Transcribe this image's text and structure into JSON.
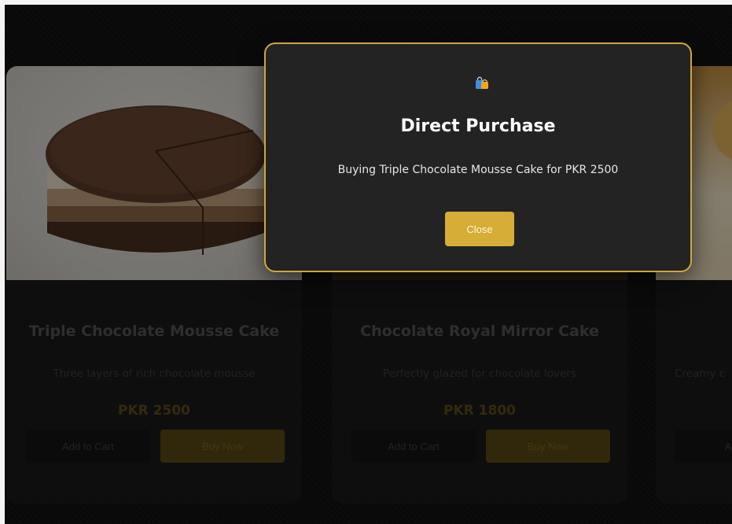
{
  "products": [
    {
      "title": "Triple Chocolate Mousse Cake",
      "description": "Three layers of rich chocolate mousse",
      "price": "PKR 2500",
      "add_to_cart_label": "Add to Cart",
      "buy_now_label": "Buy Now"
    },
    {
      "title": "Chocolate Royal Mirror Cake",
      "description": "Perfectly glazed for chocolate lovers",
      "price": "PKR 1800",
      "add_to_cart_label": "Add to Cart",
      "buy_now_label": "Buy Now"
    },
    {
      "title": "",
      "description": "Creamy c",
      "price": "",
      "add_to_cart_label": "Add t",
      "buy_now_label": ""
    }
  ],
  "modal": {
    "icon": "shopping-bag-icon",
    "title": "Direct Purchase",
    "message": "Buying Triple Chocolate Mousse Cake for PKR 2500",
    "close_label": "Close"
  },
  "colors": {
    "accent": "#d6ad36",
    "modal_border": "#cfa63a",
    "modal_background": "#232323",
    "page_background": "#111111"
  }
}
